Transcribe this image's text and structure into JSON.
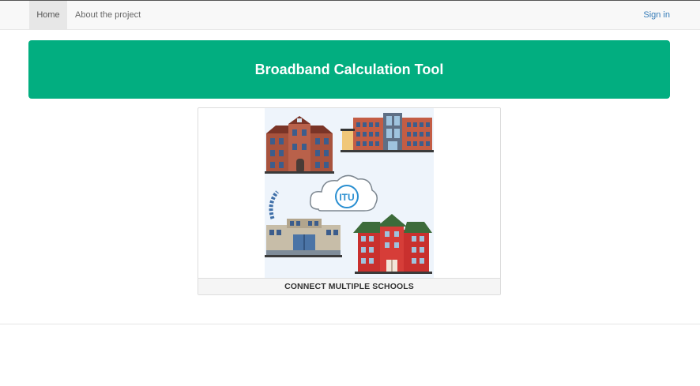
{
  "nav": {
    "home_label": "Home",
    "about_label": "About the project",
    "signin_label": "Sign in"
  },
  "banner": {
    "title": "Broadband Calculation Tool",
    "color": "#02ae80"
  },
  "card": {
    "logo_text": "ITU",
    "label": "CONNECT MULTIPLE SCHOOLS"
  },
  "colors": {
    "accent": "#02ae80",
    "link": "#337ab7"
  }
}
